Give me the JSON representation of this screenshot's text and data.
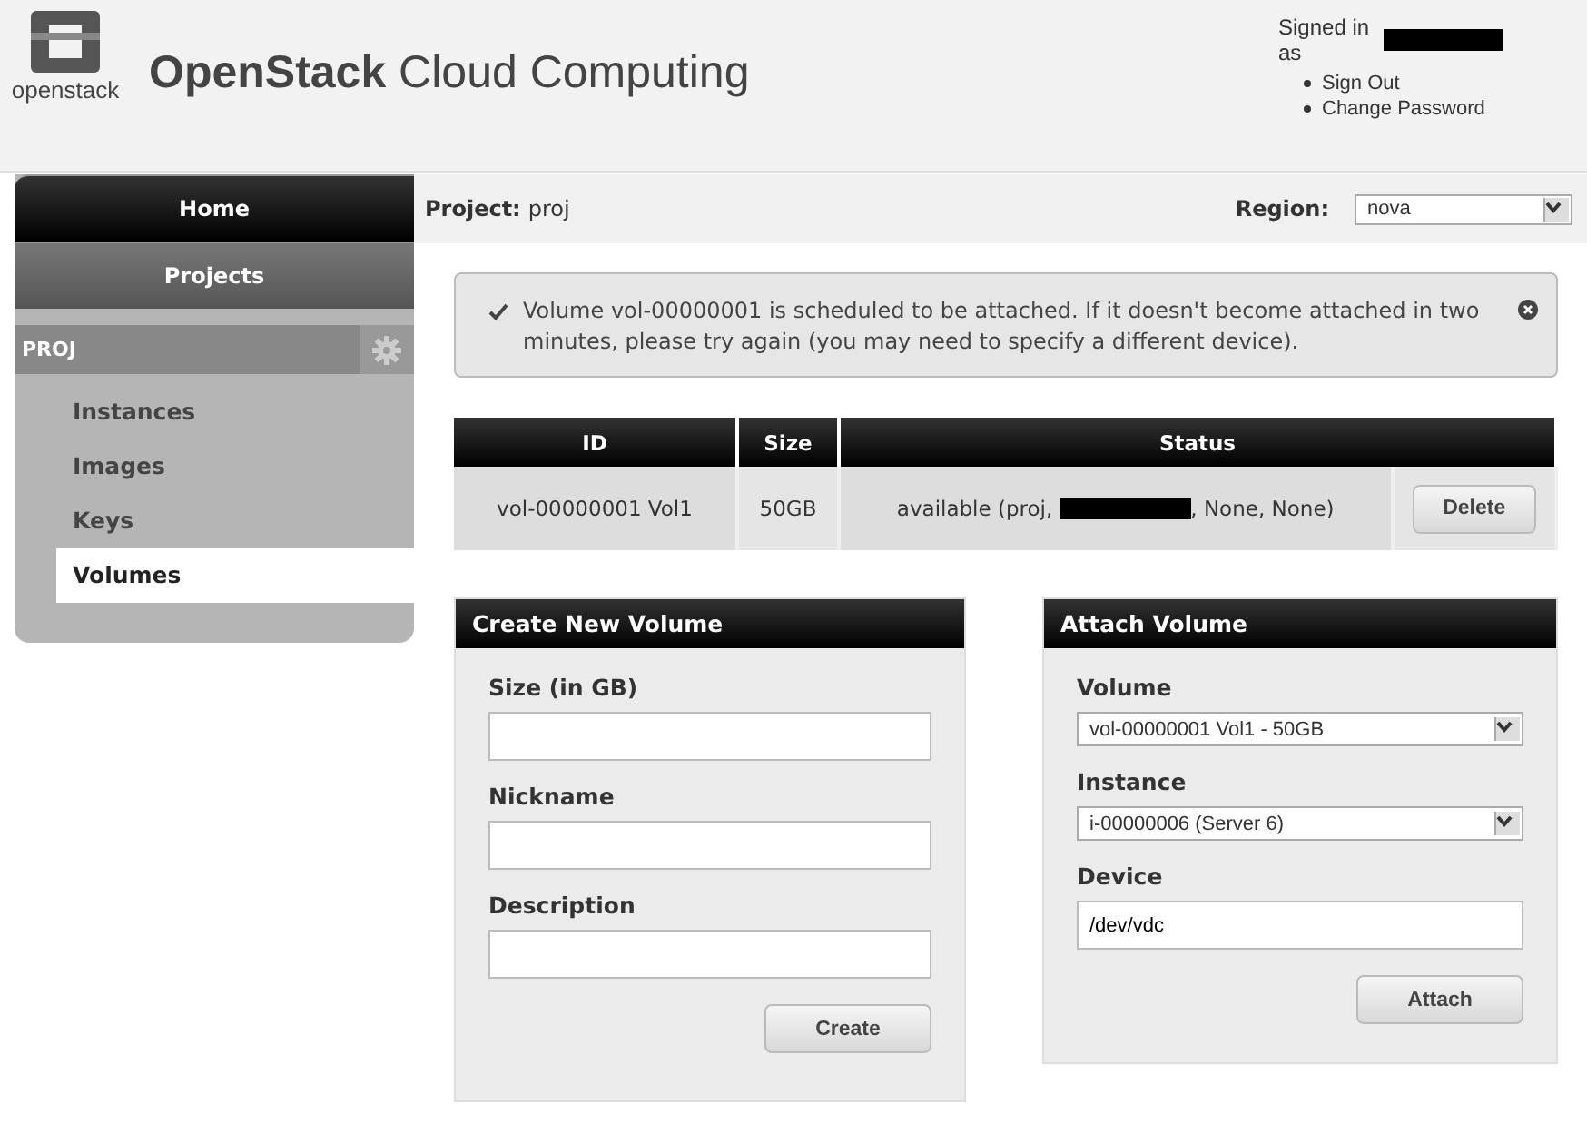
{
  "header": {
    "logo_text": "openstack",
    "title_bold": "OpenStack",
    "title_rest": "Cloud Computing",
    "signed_in": "Signed in as",
    "links": [
      "Sign Out",
      "Change Password"
    ]
  },
  "sidebar": {
    "items": [
      {
        "label": "Home",
        "selected": true
      },
      {
        "label": "Projects",
        "selected": false
      }
    ],
    "project": "PROJ",
    "nav": [
      {
        "label": "Instances",
        "selected": false
      },
      {
        "label": "Images",
        "selected": false
      },
      {
        "label": "Keys",
        "selected": false
      },
      {
        "label": "Volumes",
        "selected": true
      }
    ]
  },
  "project_bar": {
    "label": "Project:",
    "value": "proj",
    "region_label": "Region:",
    "region": "nova"
  },
  "message": {
    "text": "Volume vol-00000001 is scheduled to be attached. If it doesn't become attached in two minutes, please try again (you may need to specify a different device)."
  },
  "table": {
    "columns": [
      "ID",
      "Size",
      "Status"
    ],
    "rows": [
      {
        "id": "vol-00000001 Vol1",
        "size": "50GB",
        "status_before": "available (proj,",
        "status_after": ", None, None)",
        "action": "Delete"
      }
    ]
  },
  "create_panel": {
    "title": "Create New Volume",
    "fields": [
      {
        "label": "Size (in GB)"
      },
      {
        "label": "Nickname"
      },
      {
        "label": "Description"
      }
    ],
    "button": "Create"
  },
  "attach_panel": {
    "title": "Attach Volume",
    "fields": [
      {
        "kind": "select",
        "label": "Volume",
        "value": "vol-00000001 Vol1 - 50GB"
      },
      {
        "kind": "select",
        "label": "Instance",
        "value": "i-00000006 (Server 6)"
      },
      {
        "kind": "text",
        "label": "Device",
        "value": "/dev/vdc"
      }
    ],
    "button": "Attach"
  }
}
